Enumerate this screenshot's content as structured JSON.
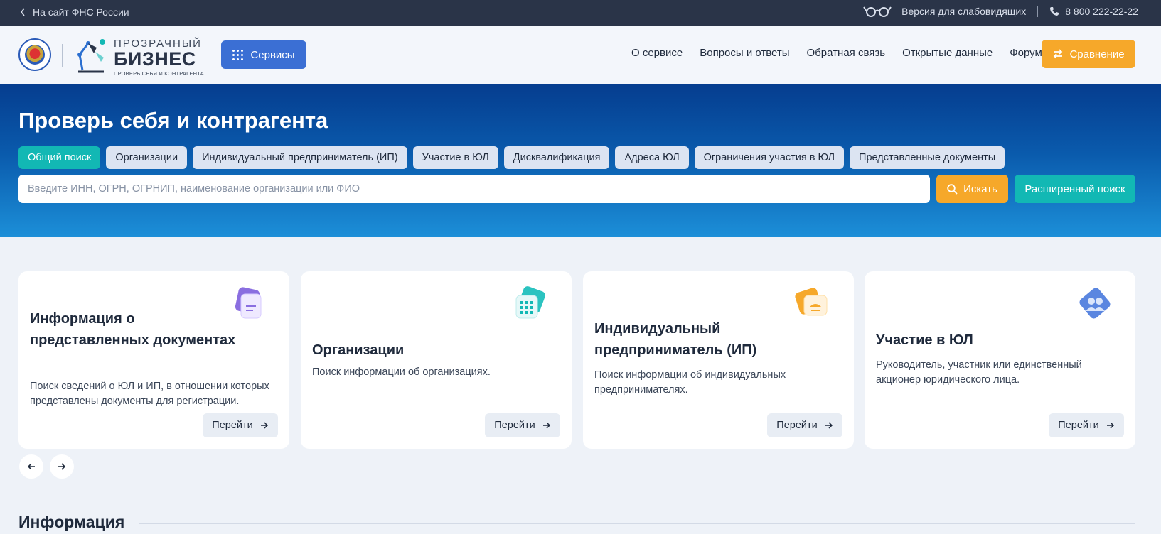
{
  "topbar": {
    "back_link": "На сайт ФНС России",
    "accessibility": "Версия для слабовидящих",
    "phone": "8 800 222-22-22"
  },
  "header": {
    "logo": {
      "line1": "ПРОЗРАЧНЫЙ",
      "line2": "БИЗНЕС",
      "line3": "ПРОВЕРЬ СЕБЯ И КОНТРАГЕНТА"
    },
    "services_label": "Сервисы",
    "nav": [
      "О сервисе",
      "Вопросы и ответы",
      "Обратная связь",
      "Открытые данные",
      "Форум"
    ],
    "compare_label": "Сравнение"
  },
  "hero": {
    "title": "Проверь себя и контрагента",
    "tabs": [
      "Общий поиск",
      "Организации",
      "Индивидуальный предприниматель (ИП)",
      "Участие в ЮЛ",
      "Дисквалификация",
      "Адреса ЮЛ",
      "Ограничения участия в ЮЛ",
      "Представленные документы"
    ],
    "active_tab": "Общий поиск",
    "search_placeholder": "Введите ИНН, ОГРН, ОГРНИП, наименование организации или ФИО",
    "search_value": "",
    "search_label": "Искать",
    "advanced_label": "Расширенный поиск"
  },
  "cards": [
    {
      "title": "Информация о представленных документах",
      "desc": "Поиск сведений о ЮЛ и ИП, в отношении которых представлены документы для регистрации.",
      "go": "Перейти",
      "icon": "documents-icon"
    },
    {
      "title": "Организации",
      "desc": "Поиск информации об организациях.",
      "go": "Перейти",
      "icon": "organization-icon"
    },
    {
      "title": "Индивидуальный предприниматель (ИП)",
      "desc": "Поиск информации об индивидуальных предпринимателях.",
      "go": "Перейти",
      "icon": "entrepreneur-icon"
    },
    {
      "title": "Участие в ЮЛ",
      "desc": "Руководитель, участник или единственный акционер юридического лица.",
      "go": "Перейти",
      "icon": "participants-icon"
    }
  ],
  "section": {
    "info_title": "Информация"
  },
  "colors": {
    "topbar": "#2a3448",
    "primary_blue": "#3b6fd4",
    "accent_orange": "#f6a82a",
    "accent_teal": "#12b8b4",
    "hero_dark": "#053d8f",
    "hero_light": "#1c8fd8"
  }
}
